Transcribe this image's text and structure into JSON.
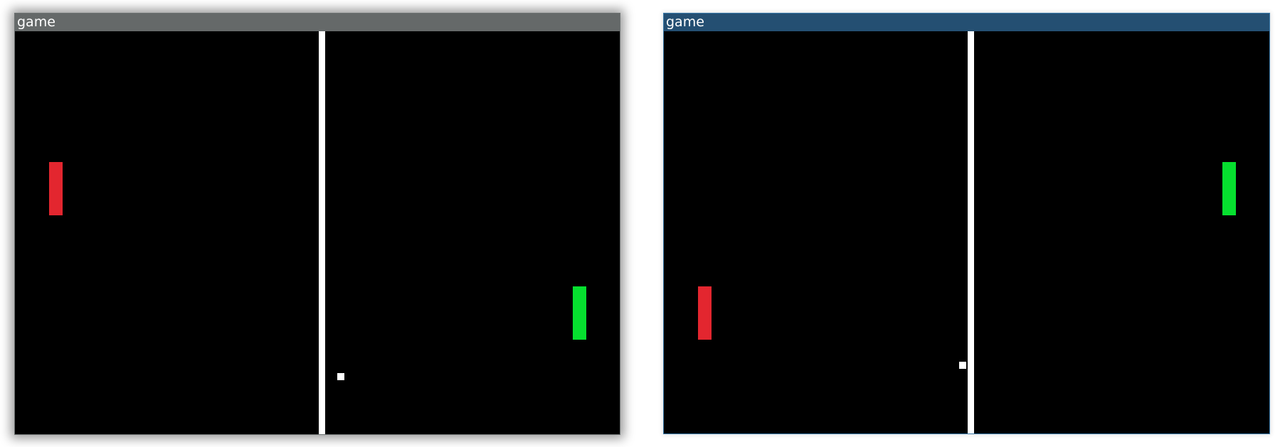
{
  "windows": [
    {
      "title": "game",
      "state": "inactive",
      "titlebar_color": "#656969",
      "court": {
        "background": "#000000",
        "center_line_color": "#ffffff",
        "left_paddle": {
          "color": "#e3262f"
        },
        "right_paddle": {
          "color": "#06e02f"
        },
        "ball": {
          "color": "#ffffff"
        }
      }
    },
    {
      "title": "game",
      "state": "active",
      "titlebar_color": "#244f72",
      "court": {
        "background": "#000000",
        "center_line_color": "#ffffff",
        "left_paddle": {
          "color": "#e3262f"
        },
        "right_paddle": {
          "color": "#06e02f"
        },
        "ball": {
          "color": "#ffffff"
        }
      }
    }
  ]
}
